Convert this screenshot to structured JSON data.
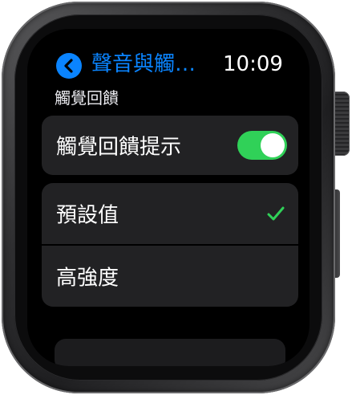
{
  "nav": {
    "back_icon": "chevron-left-icon",
    "title": "聲音與觸…",
    "time": "10:09"
  },
  "section": {
    "header": "觸覺回饋"
  },
  "toggle_row": {
    "label": "觸覺回饋提示",
    "state": "on"
  },
  "options": [
    {
      "label": "預設值",
      "selected": true
    },
    {
      "label": "高強度",
      "selected": false
    }
  ],
  "colors": {
    "accent": "#0a84ff",
    "toggle_on": "#30d158",
    "checkmark": "#30d158",
    "cell_background": "#222224",
    "screen_background": "#000000"
  }
}
